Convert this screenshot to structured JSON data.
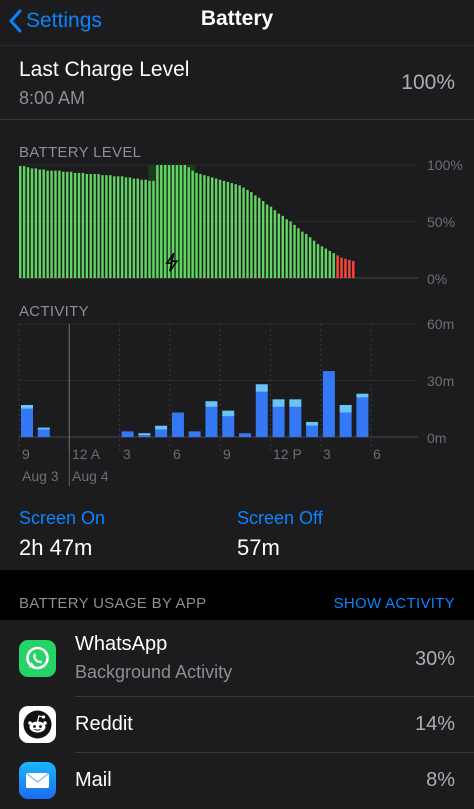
{
  "nav": {
    "back_label": "Settings",
    "title": "Battery"
  },
  "last_charge": {
    "title": "Last Charge Level",
    "time": "8:00 AM",
    "value": "100%"
  },
  "battery_level": {
    "label": "BATTERY LEVEL",
    "y_ticks": [
      "100%",
      "50%",
      "0%"
    ],
    "chart_data": {
      "type": "bar",
      "title": "BATTERY LEVEL",
      "ylim": [
        0,
        100
      ],
      "unit": "%",
      "values": [
        99,
        99,
        98,
        97,
        97,
        96,
        96,
        95,
        95,
        95,
        95,
        94,
        94,
        94,
        93,
        93,
        93,
        92,
        92,
        92,
        92,
        91,
        91,
        91,
        90,
        90,
        90,
        89,
        89,
        88,
        88,
        87,
        87,
        86,
        86,
        100,
        100,
        100,
        100,
        100,
        100,
        100,
        100,
        98,
        95,
        93,
        92,
        91,
        90,
        89,
        88,
        87,
        86,
        85,
        84,
        83,
        82,
        80,
        78,
        76,
        73,
        71,
        68,
        65,
        63,
        60,
        57,
        55,
        52,
        50,
        47,
        44,
        41,
        39,
        36,
        33,
        30,
        28,
        26,
        24,
        22,
        20,
        18,
        17,
        16,
        15
      ],
      "charging_range": [
        33,
        45
      ],
      "low_threshold": 20,
      "colors": {
        "normal": "#61d464",
        "low": "#ff453a"
      }
    }
  },
  "activity": {
    "label": "ACTIVITY",
    "y_ticks": [
      "60m",
      "30m",
      "0m"
    ],
    "x_ticks": [
      "9",
      "12 A",
      "3",
      "6",
      "9",
      "12 P",
      "3",
      "6"
    ],
    "x_dates": [
      "Aug 3",
      "Aug 4"
    ],
    "chart_data": {
      "type": "bar",
      "title": "ACTIVITY",
      "ylim": [
        0,
        60
      ],
      "unit": "minutes",
      "hours": [
        "9 PM",
        "10 PM",
        "11 PM",
        "12 AM",
        "1 AM",
        "2 AM",
        "3 AM",
        "4 AM",
        "5 AM",
        "6 AM",
        "7 AM",
        "8 AM",
        "9 AM",
        "10 AM",
        "11 AM",
        "12 PM",
        "1 PM",
        "2 PM",
        "3 PM",
        "4 PM",
        "5 PM"
      ],
      "series": [
        {
          "name": "Screen On",
          "color": "#3478f6",
          "values": [
            15,
            4,
            0,
            0,
            0,
            0,
            3,
            1,
            4,
            13,
            3,
            16,
            11,
            2,
            24,
            16,
            16,
            6,
            35,
            13,
            21
          ]
        },
        {
          "name": "Screen Off",
          "color": "#68c3f7",
          "values": [
            2,
            1,
            0,
            0,
            0,
            0,
            0,
            1,
            2,
            0,
            0,
            3,
            3,
            0,
            4,
            4,
            4,
            2,
            0,
            4,
            2
          ]
        }
      ]
    }
  },
  "screen_on": {
    "label": "Screen On",
    "value": "2h 47m"
  },
  "screen_off": {
    "label": "Screen Off",
    "value": "57m"
  },
  "usage": {
    "header": "BATTERY USAGE BY APP",
    "show_activity": "SHOW ACTIVITY",
    "apps": [
      {
        "name": "WhatsApp",
        "sub": "Background Activity",
        "pct": "30%",
        "icon": "whatsapp-icon"
      },
      {
        "name": "Reddit",
        "pct": "14%",
        "icon": "reddit-icon"
      },
      {
        "name": "Mail",
        "pct": "8%",
        "icon": "mail-icon"
      }
    ]
  }
}
